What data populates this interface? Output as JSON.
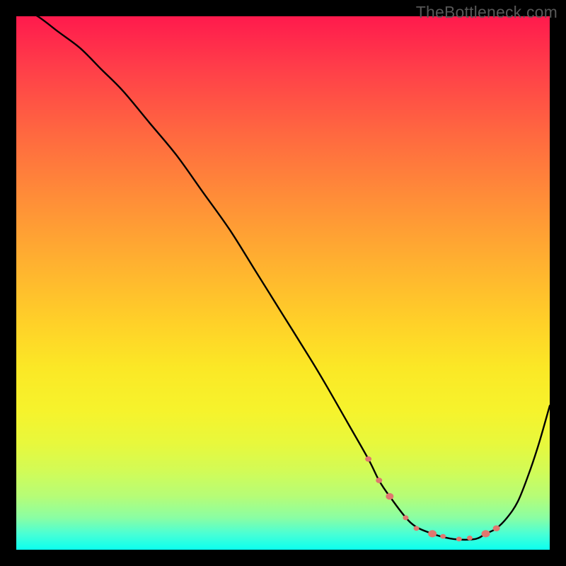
{
  "watermark": "TheBottleneck.com",
  "colors": {
    "page_bg": "#000000",
    "gradient_top": "#ff1a4d",
    "gradient_bottom": "#0bffef",
    "curve_stroke": "#000000",
    "marker_fill": "#e0776f",
    "watermark_text": "#575757"
  },
  "chart_data": {
    "type": "line",
    "title": "",
    "xlabel": "",
    "ylabel": "",
    "xlim": [
      0,
      100
    ],
    "ylim": [
      0,
      100
    ],
    "series": [
      {
        "name": "bottleneck-curve",
        "x": [
          0,
          4,
          8,
          12,
          16,
          20,
          25,
          30,
          35,
          40,
          45,
          50,
          55,
          58,
          62,
          66,
          68,
          70,
          74,
          78,
          82,
          86,
          88,
          90,
          92,
          94,
          96,
          98,
          100
        ],
        "values": [
          102,
          100,
          97,
          94,
          90,
          86,
          80,
          74,
          67,
          60,
          52,
          44,
          36,
          31,
          24,
          17,
          13,
          10,
          5,
          3,
          2,
          2,
          3,
          4,
          6,
          9,
          14,
          20,
          27
        ]
      }
    ],
    "markers": {
      "name": "highlight-points",
      "x": [
        66,
        68,
        70,
        73,
        75,
        78,
        80,
        83,
        85,
        88,
        90
      ],
      "values": [
        17,
        13,
        10,
        6,
        4,
        3,
        2.5,
        2,
        2.2,
        3,
        4
      ],
      "r": [
        4.5,
        4.5,
        5.5,
        4,
        4,
        6,
        4,
        4,
        4,
        6,
        5
      ]
    }
  }
}
